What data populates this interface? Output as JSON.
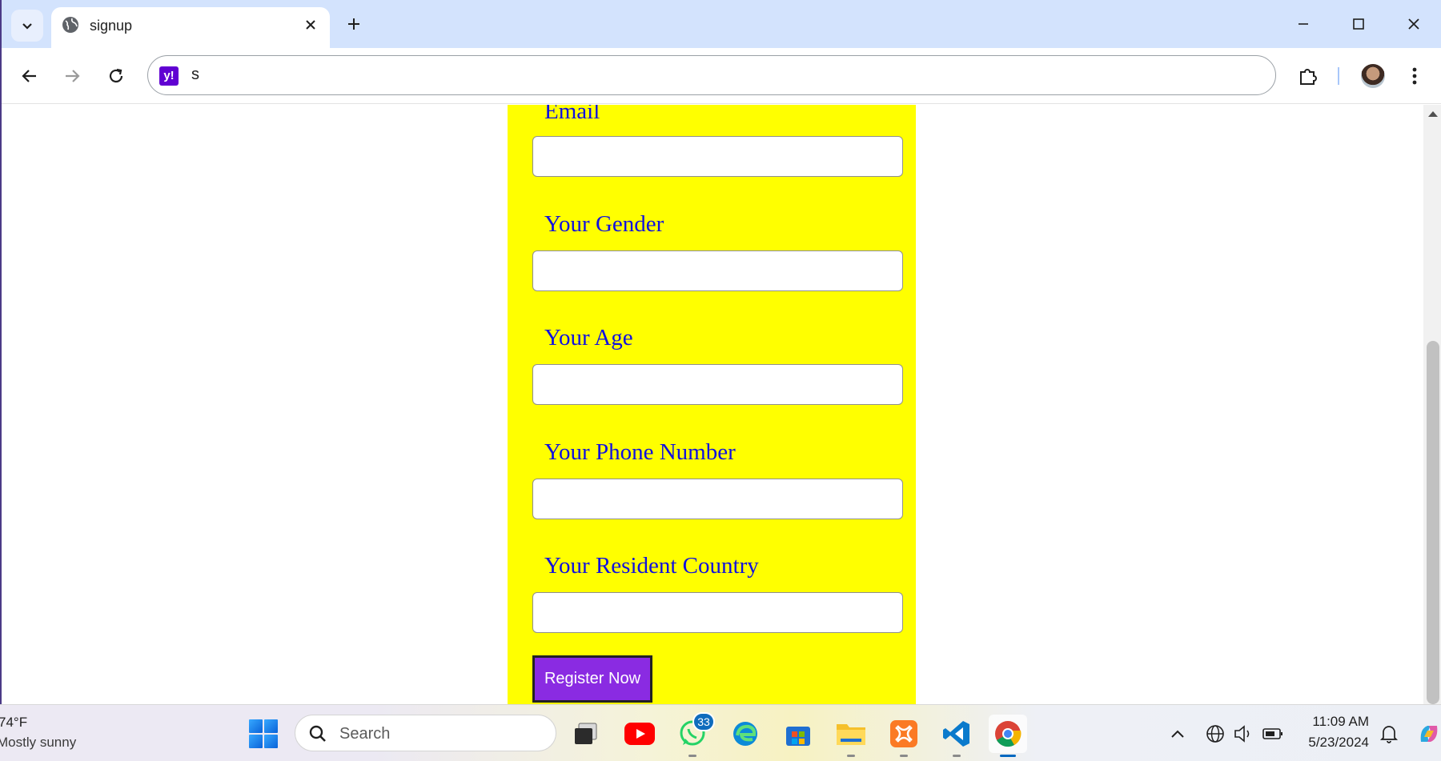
{
  "browser": {
    "tab_title": "signup",
    "address_text": "s",
    "favicon_letter": "y!"
  },
  "form": {
    "fields": [
      {
        "label": "Email",
        "value": ""
      },
      {
        "label": "Your Gender",
        "value": ""
      },
      {
        "label": "Your Age",
        "value": ""
      },
      {
        "label": "Your Phone Number",
        "value": ""
      },
      {
        "label": "Your Resident Country",
        "value": ""
      }
    ],
    "submit_label": "Register Now"
  },
  "colors": {
    "panel_background": "#ffff00",
    "label_color": "#1010e0",
    "button_background": "#8a2be2"
  },
  "taskbar": {
    "weather_temp": "74°F",
    "weather_desc": "Mostly sunny",
    "search_placeholder": "Search",
    "whatsapp_badge": "33",
    "time": "11:09 AM",
    "date": "5/23/2024",
    "apps": [
      "file-explorer-task",
      "youtube",
      "whatsapp",
      "edge",
      "microsoft-store",
      "file-explorer",
      "xampp",
      "vscode",
      "chrome"
    ]
  }
}
